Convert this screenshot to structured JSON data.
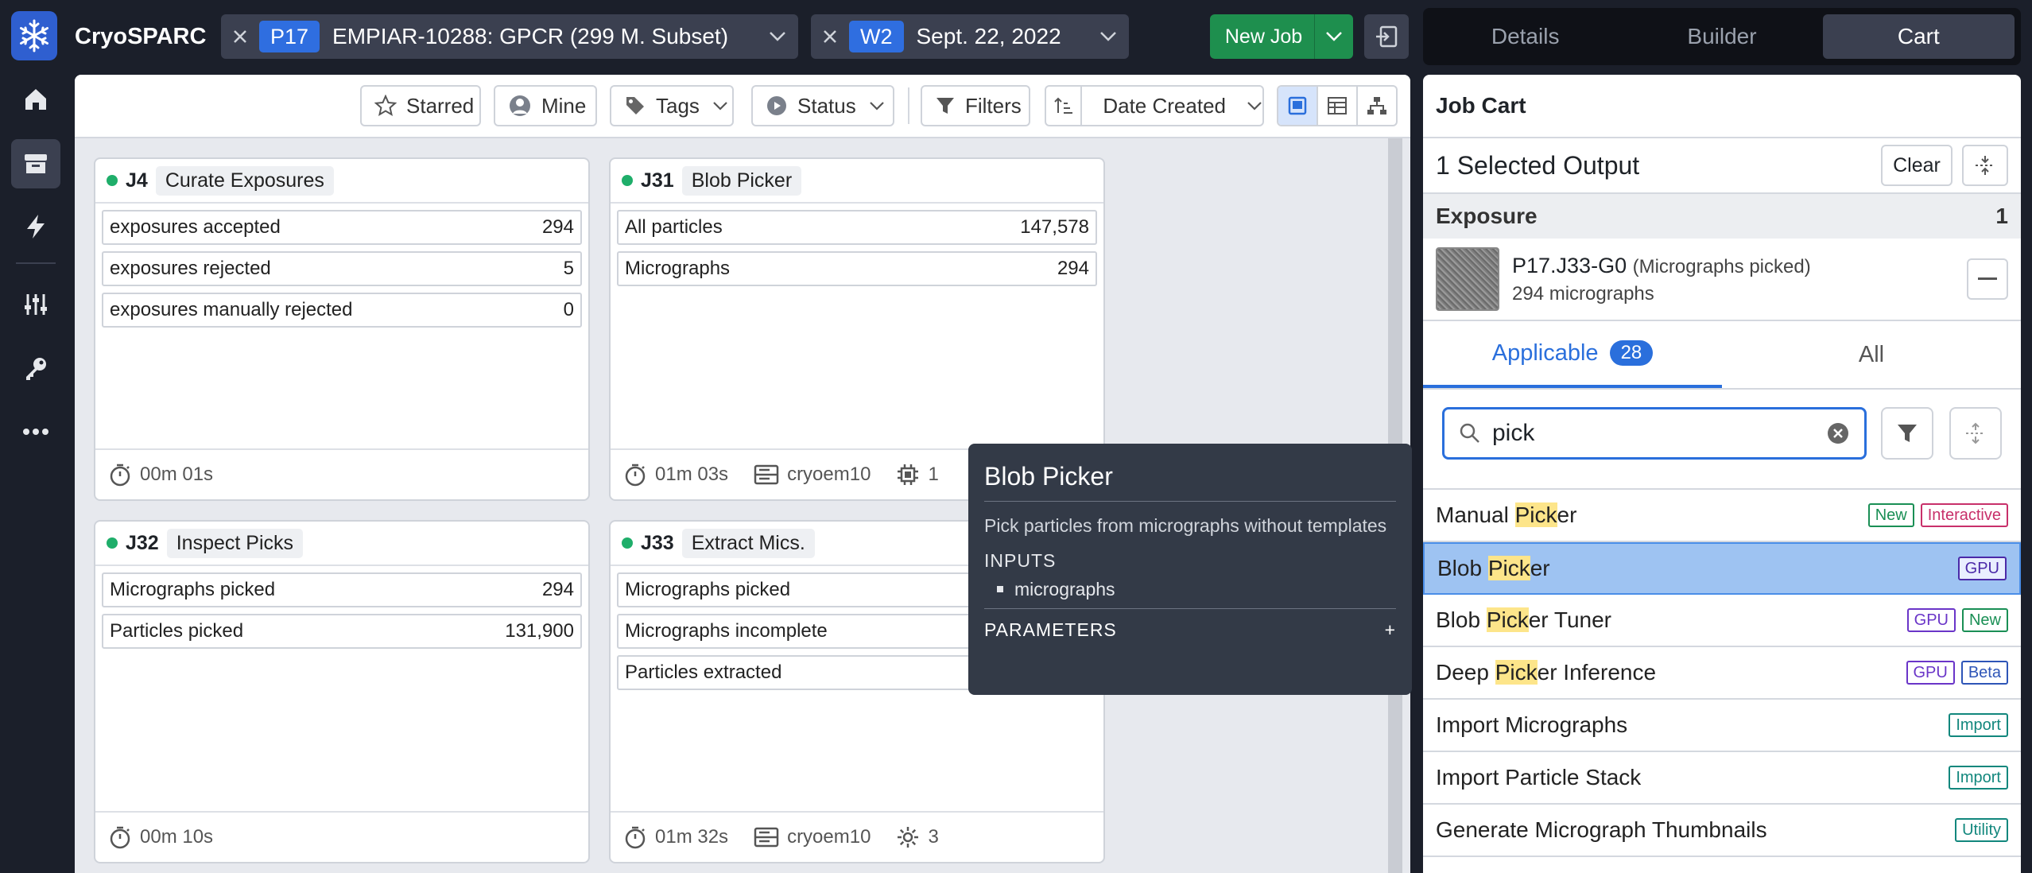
{
  "app": {
    "name": "CryoSPARC"
  },
  "breadcrumbs": [
    {
      "badge": "P17",
      "label": "EMPIAR-10288: GPCR (299 M. Subset)"
    },
    {
      "badge": "W2",
      "label": "Sept. 22, 2022"
    }
  ],
  "new_job": {
    "label": "New Job"
  },
  "right_tabs": [
    "Details",
    "Builder",
    "Cart"
  ],
  "toolbar": {
    "starred": "Starred",
    "mine": "Mine",
    "tags": "Tags",
    "status": "Status",
    "filters": "Filters",
    "sort": "Date Created"
  },
  "cards": [
    {
      "id": "J4",
      "type": "Curate Exposures",
      "rows": [
        [
          "exposures accepted",
          "294"
        ],
        [
          "exposures rejected",
          "5"
        ],
        [
          "exposures manually rejected",
          "0"
        ]
      ],
      "time": "00m 01s"
    },
    {
      "id": "J31",
      "type": "Blob Picker",
      "rows": [
        [
          "All particles",
          "147,578"
        ],
        [
          "Micrographs",
          "294"
        ]
      ],
      "time": "01m 03s",
      "host": "cryoem10",
      "gpu": "1"
    },
    {
      "id": "J32",
      "type": "Inspect Picks",
      "rows": [
        [
          "Micrographs picked",
          "294"
        ],
        [
          "Particles picked",
          "131,900"
        ]
      ],
      "time": "00m 10s"
    },
    {
      "id": "J33",
      "type": "Extract Mics.",
      "rows": [
        [
          "Micrographs picked",
          ""
        ],
        [
          "Micrographs incomplete",
          ""
        ],
        [
          "Particles extracted",
          ""
        ]
      ],
      "time": "01m 32s",
      "host": "cryoem10",
      "gpu": "3"
    }
  ],
  "tooltip": {
    "title": "Blob Picker",
    "description": "Pick particles from micrographs without templates",
    "inputs_header": "INPUTS",
    "inputs": [
      "micrographs"
    ],
    "params_header": "PARAMETERS",
    "params_toggle": "+"
  },
  "cart": {
    "title": "Job Cart",
    "selected": "1 Selected Output",
    "clear": "Clear",
    "group": {
      "label": "Exposure",
      "count": "1"
    },
    "output": {
      "name": "P17.J33-G0",
      "desc": "(Micrographs picked)",
      "sub": "294 micrographs"
    },
    "tabs": [
      {
        "label": "Applicable",
        "count": "28"
      },
      {
        "label": "All"
      }
    ],
    "search": {
      "value": "pick"
    },
    "jobs": [
      {
        "pre": "Manual ",
        "hl": "Pick",
        "post": "er",
        "tags": [
          [
            "New",
            "new"
          ],
          [
            "Interactive",
            "int"
          ]
        ]
      },
      {
        "pre": "Blob ",
        "hl": "Pick",
        "post": "er",
        "tags": [
          [
            "GPU",
            "gpusel"
          ]
        ],
        "selected": true
      },
      {
        "pre": "Blob ",
        "hl": "Pick",
        "post": "er Tuner",
        "tags": [
          [
            "GPU",
            "gpu"
          ],
          [
            "New",
            "new"
          ]
        ]
      },
      {
        "pre": "Deep ",
        "hl": "Pick",
        "post": "er Inference",
        "tags": [
          [
            "GPU",
            "gpu"
          ],
          [
            "Beta",
            "beta"
          ]
        ]
      },
      {
        "pre": "Import Micrographs",
        "hl": "",
        "post": "",
        "tags": [
          [
            "Import",
            "imp"
          ]
        ]
      },
      {
        "pre": "Import Particle Stack",
        "hl": "",
        "post": "",
        "tags": [
          [
            "Import",
            "imp"
          ]
        ]
      },
      {
        "pre": "Generate Micrograph Thumbnails",
        "hl": "",
        "post": "",
        "tags": [
          [
            "Utility",
            "util"
          ]
        ]
      }
    ]
  }
}
